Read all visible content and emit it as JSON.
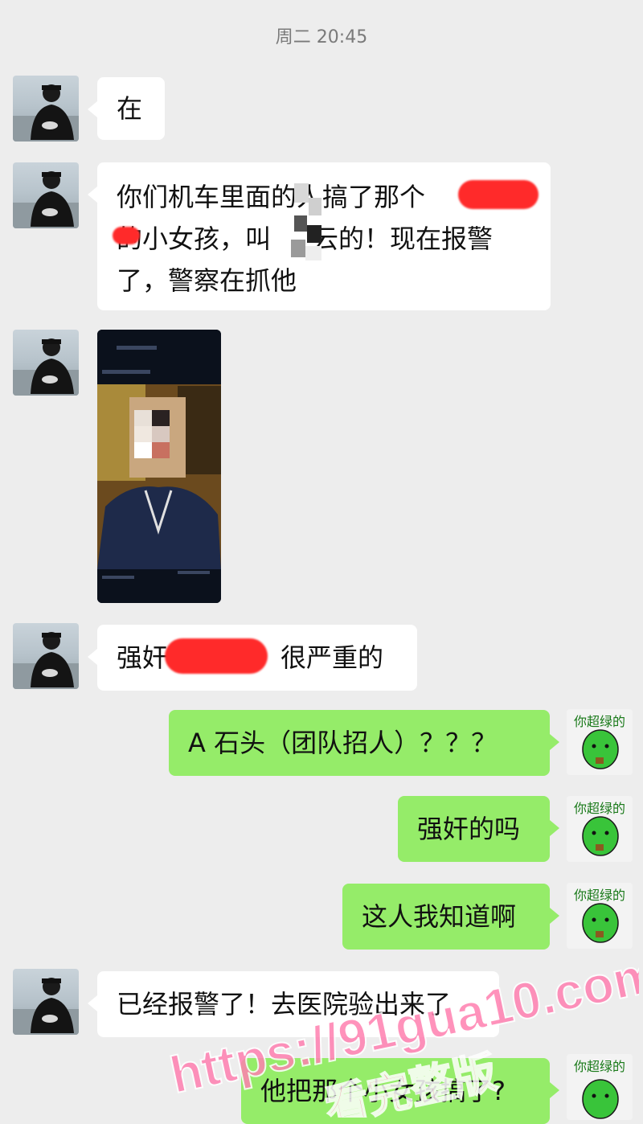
{
  "timestamp": "周二 20:45",
  "messages": {
    "m1": "在",
    "m2_line1": "你们机车里面的人搞了那个",
    "m2_line2a": "的小女孩，叫",
    "m2_line2b": "云的！现在报警",
    "m2_line3": "了，警察在抓他",
    "m4a": "强奸",
    "m4b": "很严重的",
    "m5": "A  石头（团队招人）？？？",
    "m6": "强奸的吗",
    "m7": "这人我知道啊",
    "m8": "已经报警了！去医院验出来了",
    "m9": "他把那个小女孩搞了?"
  },
  "self_avatar": {
    "label": "你超绿的"
  },
  "watermark": {
    "line1": "https://91gua10.com",
    "line2": "看完整版",
    "color": "#ff7fb0"
  },
  "colors": {
    "outgoing": "#95ec69",
    "incoming": "#ffffff",
    "background": "#ededed"
  },
  "icons": {
    "contact_avatar": "person-silhouette-icon",
    "self_avatar": "green-character-icon"
  }
}
